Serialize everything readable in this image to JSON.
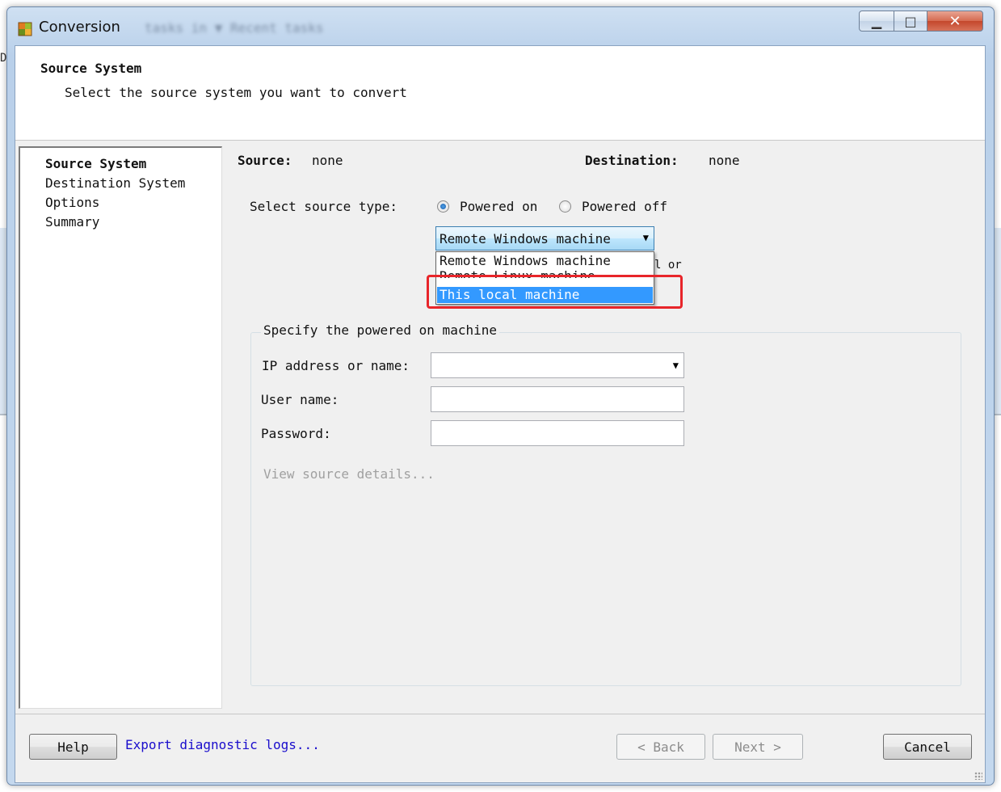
{
  "background": {
    "edge_letter": "D"
  },
  "window": {
    "title": "Conversion",
    "blurred_text": "tasks in  ▼ Recent tasks",
    "controls": {
      "minimize": "▁",
      "maximize": "□",
      "close": "✕"
    }
  },
  "header": {
    "title": "Source System",
    "subtitle": "Select the source system you want to convert"
  },
  "nav": {
    "items": [
      "Source System",
      "Destination System",
      "Options",
      "Summary"
    ],
    "active_index": 0
  },
  "summary": {
    "source_label": "Source:",
    "source_value": "none",
    "destination_label": "Destination:",
    "destination_value": "none"
  },
  "source_type": {
    "label": "Select source type:",
    "options": [
      "Powered on",
      "Powered off"
    ],
    "selected": "Powered on"
  },
  "machine_combo": {
    "value": "Remote Windows machine",
    "options": [
      "Remote Windows machine",
      "Remote Linux machine",
      "This local machine"
    ],
    "highlighted": "This local machine",
    "obscured_text": "l or"
  },
  "group": {
    "legend": "Specify the powered on machine",
    "fields": [
      {
        "label": "IP address or name:",
        "value": "",
        "type": "combo"
      },
      {
        "label": "User name:",
        "value": "",
        "type": "text"
      },
      {
        "label": "Password:",
        "value": "",
        "type": "password"
      }
    ],
    "details_link": "View source details..."
  },
  "footer": {
    "help": "Help",
    "export_link": "Export diagnostic logs...",
    "back": "< Back",
    "next": "Next >",
    "cancel": "Cancel"
  },
  "colors": {
    "highlight_box": "#e8252a",
    "selected_option_bg": "#3399ff",
    "link": "#1a0dcc"
  }
}
